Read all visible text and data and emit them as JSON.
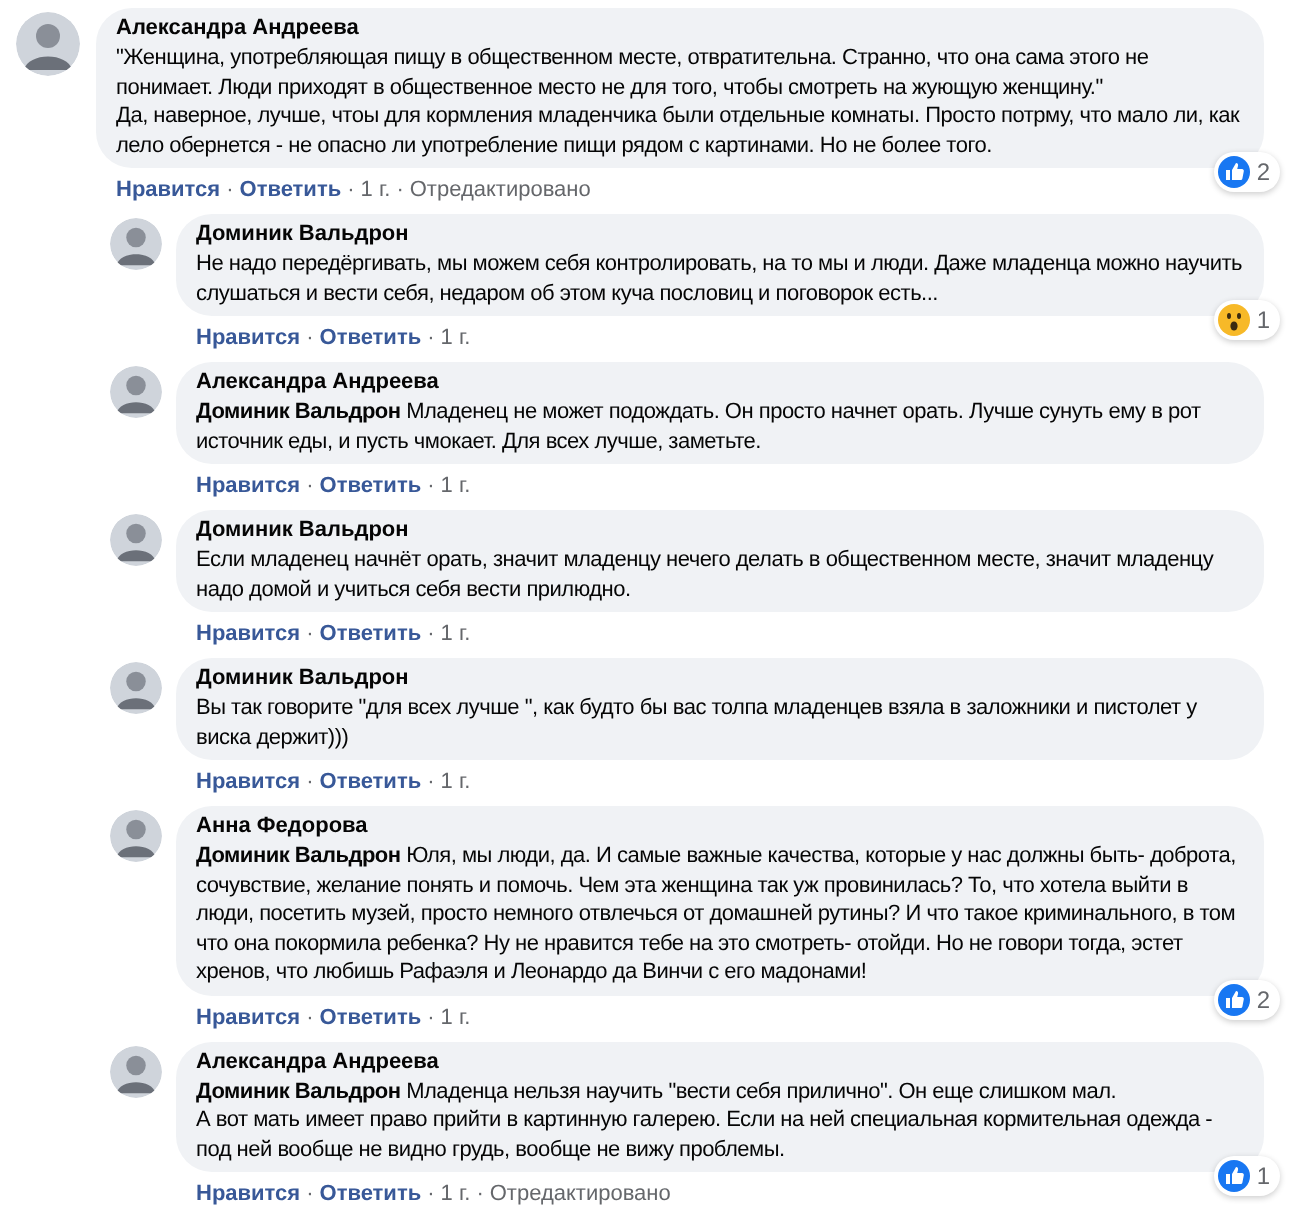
{
  "separator": "·",
  "comments": [
    {
      "kind": "top",
      "author": "Александра Андреева",
      "paragraphs": [
        "\"Женщина, употребляющая пищу в общественном месте, отвратительна. Странно, что она сама этого не понимает. Люди приходят в общественное место не для того, чтобы смотреть на жующую женщину.\"",
        "Да, наверное, лучше, чтоы для кормления младенчика были отдельные комнаты. Просто потрму, что мало ли, как лело обернется - не опасно ли употребление пищи рядом с картинами. Но не более того."
      ],
      "actions": {
        "like": "Нравится",
        "reply": "Ответить",
        "time": "1 г.",
        "edited": "Отредактировано"
      },
      "reaction": {
        "kind": "like",
        "count": "2"
      }
    },
    {
      "kind": "reply",
      "author": "Доминик Вальдрон",
      "paragraphs": [
        "Не надо передёргивать, мы можем себя контролировать, на то мы и люди. Даже младенца можно научить слушаться и вести себя, недаром об этом куча пословиц и поговорок есть..."
      ],
      "actions": {
        "like": "Нравится",
        "reply": "Ответить",
        "time": "1 г."
      },
      "reaction": {
        "kind": "wow",
        "count": "1"
      }
    },
    {
      "kind": "reply",
      "author": "Александра Андреева",
      "paragraphs": [
        "**Доминик Вальдрон** Младенец не может подождать. Он просто начнет орать. Лучше сунуть ему в рот источник еды, и пусть чмокает. Для всех лучше, заметьте."
      ],
      "actions": {
        "like": "Нравится",
        "reply": "Ответить",
        "time": "1 г."
      }
    },
    {
      "kind": "reply",
      "author": "Доминик Вальдрон",
      "paragraphs": [
        "Если младенец начнёт орать, значит младенцу нечего делать в общественном месте, значит младенцу надо домой и учиться себя вести прилюдно."
      ],
      "actions": {
        "like": "Нравится",
        "reply": "Ответить",
        "time": "1 г."
      }
    },
    {
      "kind": "reply",
      "author": "Доминик Вальдрон",
      "paragraphs": [
        "Вы так говорите \"для всех лучше \", как будто бы вас толпа младенцев взяла в заложники и пистолет у виска держит)))"
      ],
      "actions": {
        "like": "Нравится",
        "reply": "Ответить",
        "time": "1 г."
      }
    },
    {
      "kind": "reply",
      "author": "Анна Федорова",
      "paragraphs": [
        "**Доминик Вальдрон** Юля, мы люди, да. И самые важные качества, которые у нас должны быть- доброта, сочувствие, желание понять и помочь. Чем эта женщина так уж провинилась? То, что хотела выйти в люди, посетить музей, просто немного отвлечься от домашней рутины? И что такое криминального, в том что она покормила ребенка? Ну не нравится тебе на это смотреть- отойди. Но не говори тогда, эстет хренов, что любишь Рафаэля и Леонардо да Винчи с его мадонами!"
      ],
      "actions": {
        "like": "Нравится",
        "reply": "Ответить",
        "time": "1 г."
      },
      "reaction": {
        "kind": "like",
        "count": "2"
      }
    },
    {
      "kind": "reply",
      "author": "Александра Андреева",
      "paragraphs": [
        "**Доминик Вальдрон** Младенца нельзя научить \"вести себя прилично\". Он еще слишком мал.",
        "А вот мать имеет право прийти в картинную галерею. Если на ней специальная кормительная одежда - под ней вообще не видно грудь, вообще не вижу проблемы."
      ],
      "actions": {
        "like": "Нравится",
        "reply": "Ответить",
        "time": "1 г.",
        "edited": "Отредактировано"
      },
      "reaction": {
        "kind": "like",
        "count": "1"
      }
    }
  ]
}
